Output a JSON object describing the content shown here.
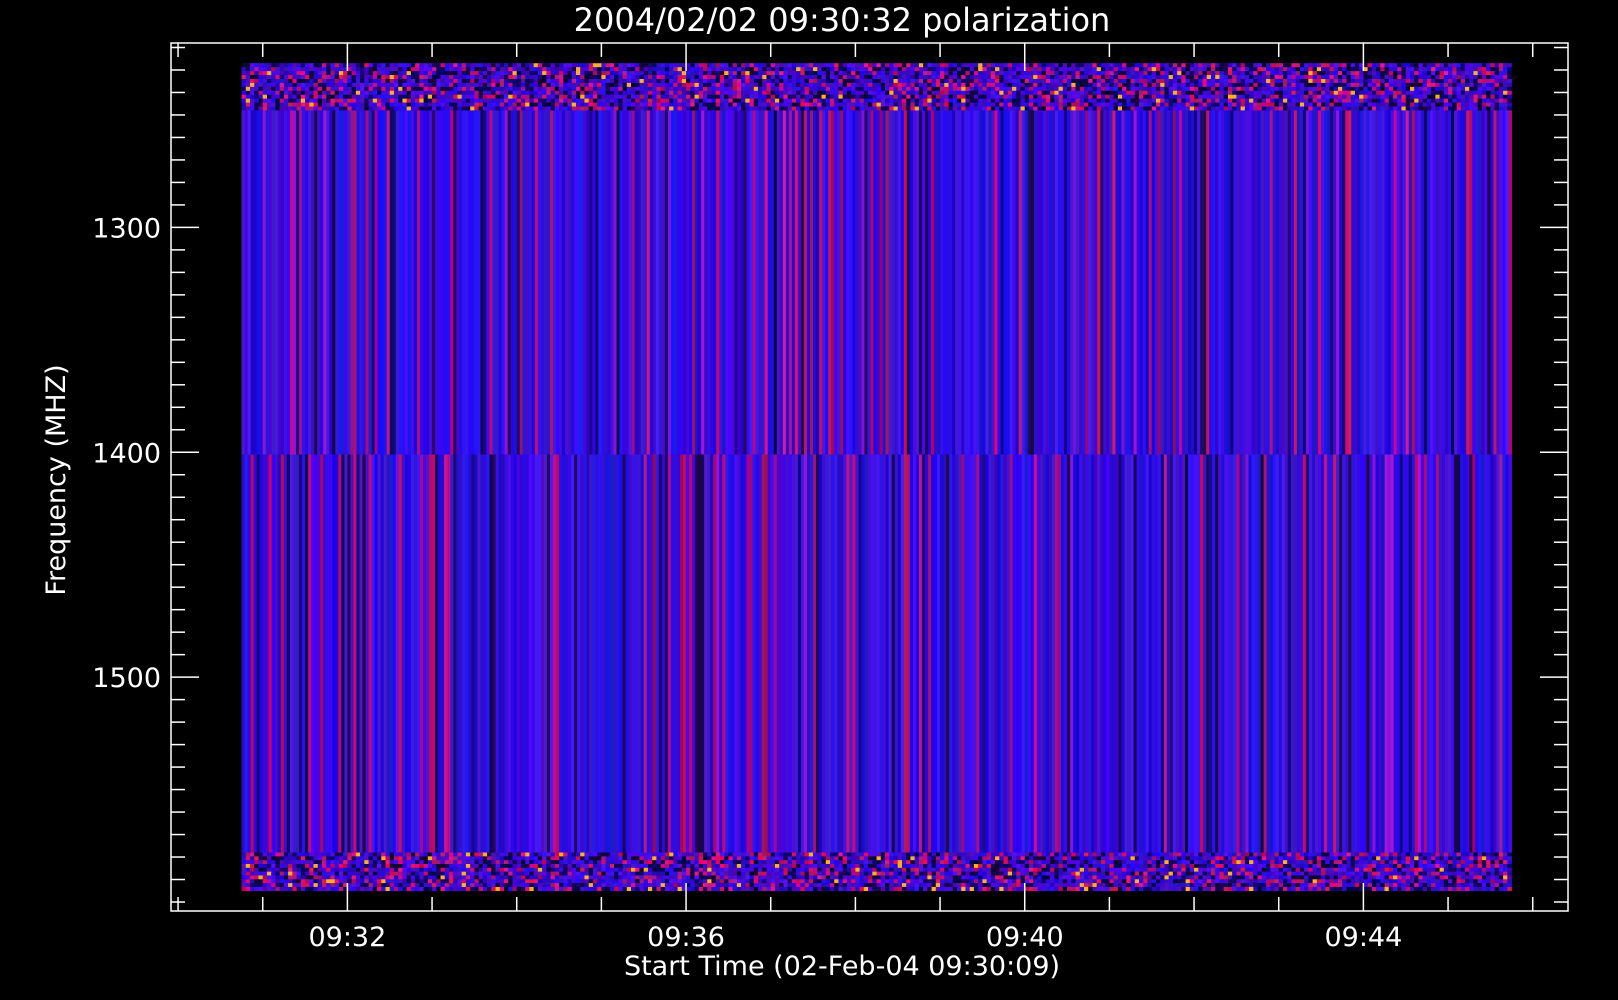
{
  "chart_data": {
    "type": "heatmap",
    "title": "2004/02/02 09:30:32 polarization",
    "xlabel": "Start Time (02-Feb-04 09:30:09)",
    "ylabel": "Frequency (MHZ)",
    "x_axis": {
      "unit": "time of day",
      "range": [
        "09:29:55",
        "09:46:25"
      ],
      "data_range": [
        "09:30:45",
        "09:45:45"
      ],
      "major_ticks": [
        "09:32",
        "09:36",
        "09:40",
        "09:44"
      ],
      "minor_tick_interval_minutes": 1
    },
    "y_axis": {
      "unit": "MHz",
      "range": [
        1218,
        1604
      ],
      "data_range": [
        1227,
        1595
      ],
      "inverted": true,
      "major_ticks": [
        1300,
        1400,
        1500
      ],
      "minor_tick_interval": 10
    },
    "bands": [
      {
        "name": "noisy-top",
        "freq_range": [
          1227,
          1248
        ],
        "pattern": "noise"
      },
      {
        "name": "upper-stripes",
        "freq_range": [
          1248,
          1401
        ],
        "pattern": "vertical-stripes"
      },
      {
        "name": "lower-stripes",
        "freq_range": [
          1401,
          1578
        ],
        "pattern": "vertical-stripes"
      },
      {
        "name": "noisy-bottom",
        "freq_range": [
          1578,
          1595
        ],
        "pattern": "noise"
      }
    ],
    "colors": {
      "background": "#000000",
      "axes": "#ffffff",
      "dominant": "#2a10e0",
      "accent_red": "#c01050",
      "dark": "#10083a",
      "highlight": "#ffb020"
    },
    "grid": false,
    "legend": "none"
  }
}
